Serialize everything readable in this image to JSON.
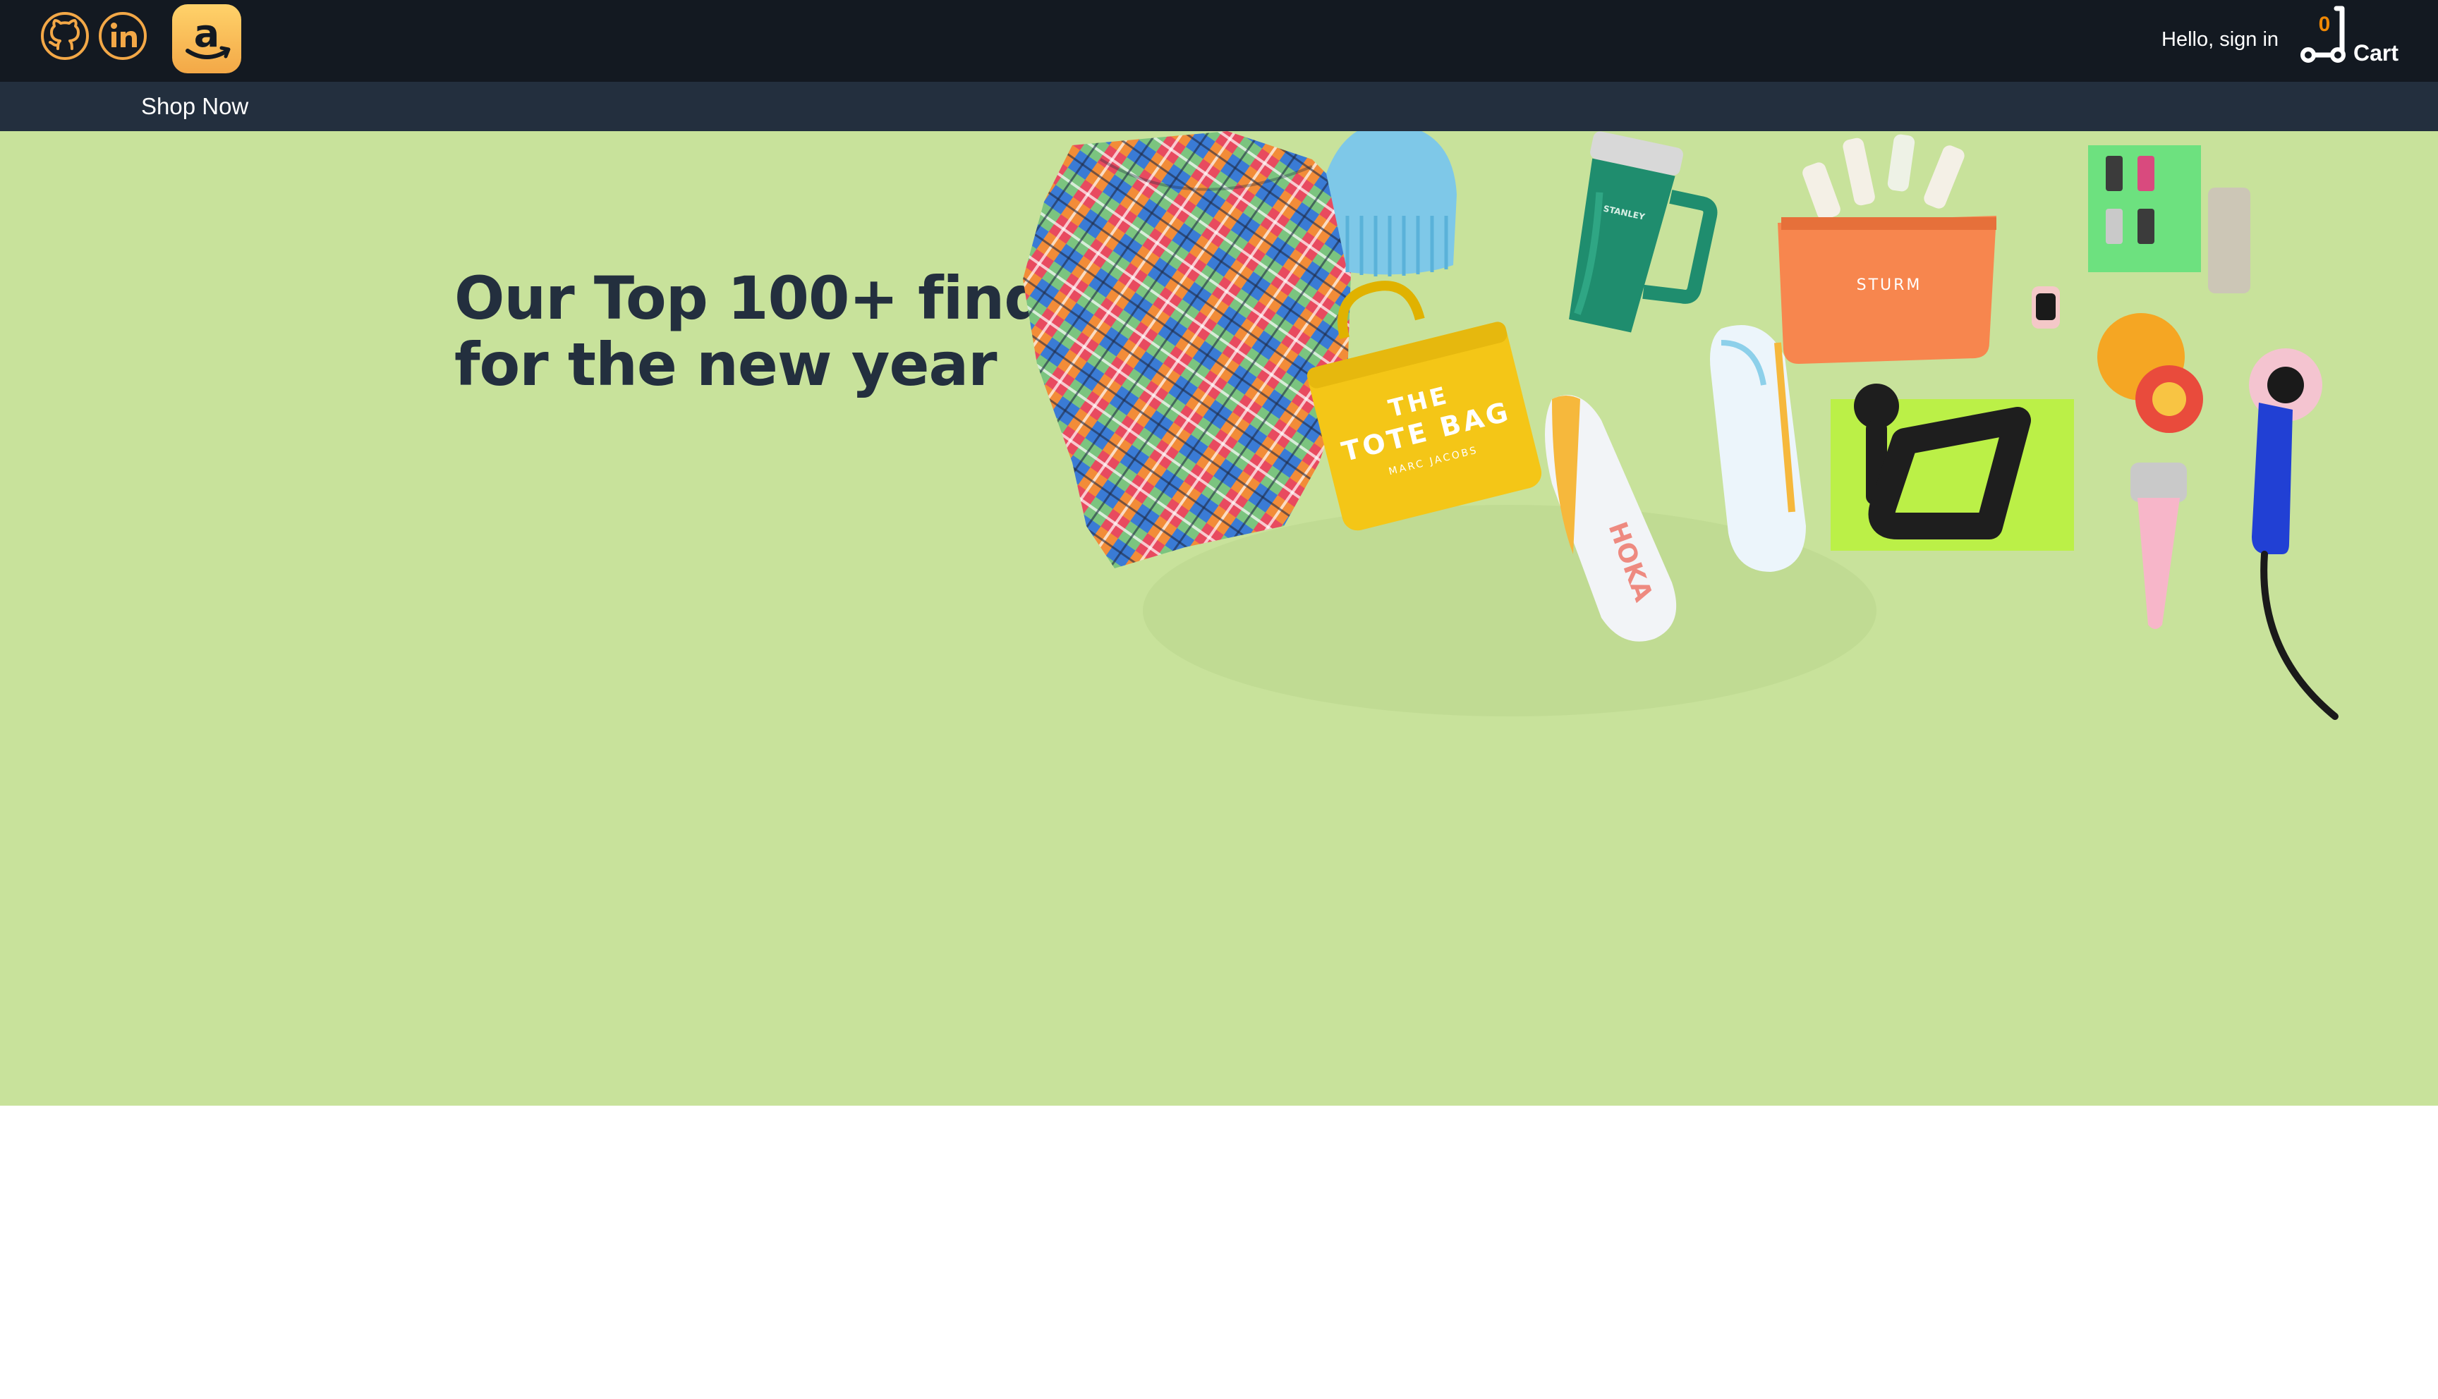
{
  "header": {
    "social": [
      {
        "icon": "github-icon"
      },
      {
        "icon": "linkedin-icon"
      }
    ],
    "logo": {
      "icon": "amazon-logo-icon",
      "colors": [
        "#ffd26a",
        "#f3a847"
      ]
    },
    "signin_label": "Hello, sign in",
    "cart": {
      "count": "0",
      "label": "Cart",
      "icon": "cart-icon"
    },
    "colors": {
      "bar": "#131921",
      "accent": "#f3a847",
      "cart_count": "#f08804"
    }
  },
  "subnav": {
    "shop_now_label": "Shop Now",
    "color": "#232f3e"
  },
  "hero": {
    "title_line1": "Our Top 100+ finds",
    "title_line2": "for the new year",
    "background": "#c8e29b",
    "products": {
      "tote_bag_line1": "THE",
      "tote_bag_line2": "TOTE BAG",
      "tote_bag_brand": "MARC JACOBS",
      "pouch_brand": "STURM",
      "sneaker_brand": "HOKA",
      "tumbler_brand": "STANLEY"
    }
  }
}
